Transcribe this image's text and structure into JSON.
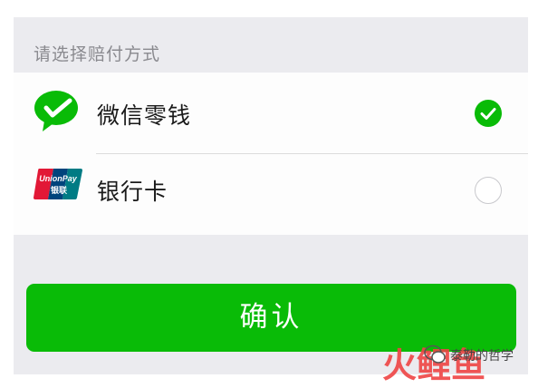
{
  "header": {
    "title": "请选择赔付方式"
  },
  "options": [
    {
      "label": "微信零钱",
      "icon": "wechat-pay-icon",
      "selected": true
    },
    {
      "label": "银行卡",
      "icon": "unionpay-icon",
      "selected": false
    }
  ],
  "unionpay": {
    "brand_text": "UnionPay",
    "cn_text": "银联"
  },
  "confirm": {
    "label": "确认"
  },
  "watermark": {
    "caption": "泰勒的哲学",
    "logo_text": "火鲤鱼"
  },
  "colors": {
    "accent": "#09bb07",
    "panel_bg": "#ebebef",
    "list_bg": "#fdfdfd",
    "header_text": "#8a8a8f"
  }
}
